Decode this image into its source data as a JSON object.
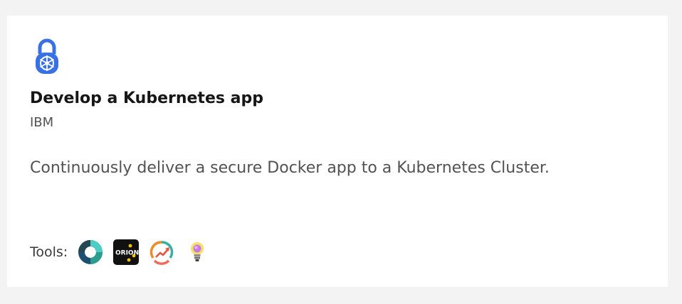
{
  "card": {
    "title": "Develop a Kubernetes app",
    "provider": "IBM",
    "description": "Continuously deliver a secure Docker app to a Kubernetes Cluster.",
    "logo_icon": "kubernetes-lock-icon",
    "tools_label": "Tools:",
    "tools": [
      {
        "icon": "delivery-pipeline-icon"
      },
      {
        "icon": "orion-web-ide-icon",
        "logo_text": "ORION"
      },
      {
        "icon": "devops-insights-icon"
      },
      {
        "icon": "lightbulb-icon"
      }
    ]
  },
  "colors": {
    "background": "#f3f3f3",
    "card": "#ffffff",
    "title": "#161616",
    "text": "#525252",
    "kubernetes_blue": "#3970e4"
  }
}
